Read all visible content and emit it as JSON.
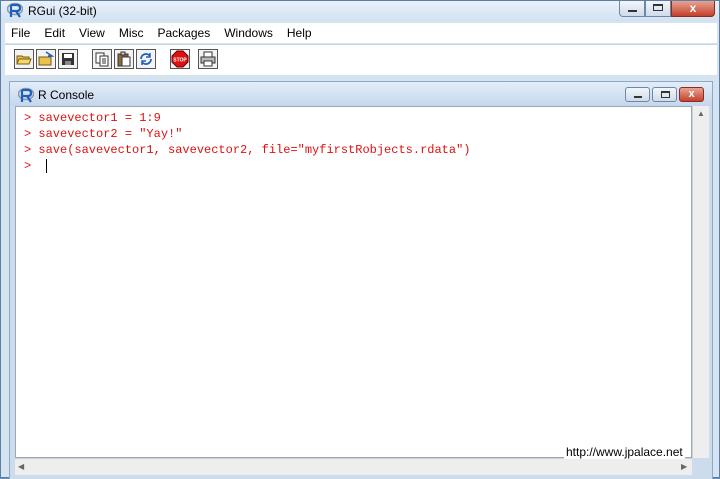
{
  "app": {
    "title": "RGui (32-bit)"
  },
  "window_controls": {
    "close_glyph": "x"
  },
  "menus": [
    "File",
    "Edit",
    "View",
    "Misc",
    "Packages",
    "Windows",
    "Help"
  ],
  "toolbar": {
    "buttons": [
      "open-script-icon",
      "load-workspace-icon",
      "save-workspace-icon",
      "copy-icon",
      "paste-icon",
      "copy-paste-icon",
      "stop-icon",
      "print-icon"
    ],
    "stop_label": "STOP"
  },
  "console": {
    "title": "R Console",
    "prompt": ">",
    "lines": [
      "> savevector1 = 1:9",
      "> savevector2 = \"Yay!\"",
      "> save(savevector1, savevector2, file=\"myfirstRobjects.rdata\")",
      "> "
    ],
    "text_color": "#e01010"
  },
  "watermark": "http://www.jpalace.net"
}
